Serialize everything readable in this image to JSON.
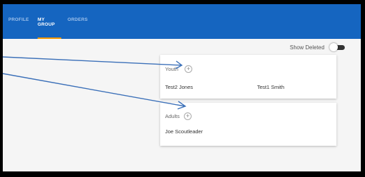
{
  "nav": {
    "tabs": [
      {
        "label": "PROFILE",
        "active": false
      },
      {
        "label": "MY GROUP",
        "active": true
      },
      {
        "label": "ORDERS",
        "active": false
      }
    ]
  },
  "controls": {
    "show_deleted_label": "Show Deleted",
    "show_deleted_on": false
  },
  "groups": [
    {
      "title": "Youth",
      "members": [
        "Test2 Jones",
        "Test1 Smith"
      ]
    },
    {
      "title": "Adults",
      "members": [
        "Joe Scoutleader"
      ]
    }
  ],
  "icons": {
    "add": "add-circle-icon"
  },
  "colors": {
    "appbar": "#1565c0",
    "active_tab_indicator": "#ff9800",
    "annotation_arrow": "#3a6fb8"
  }
}
